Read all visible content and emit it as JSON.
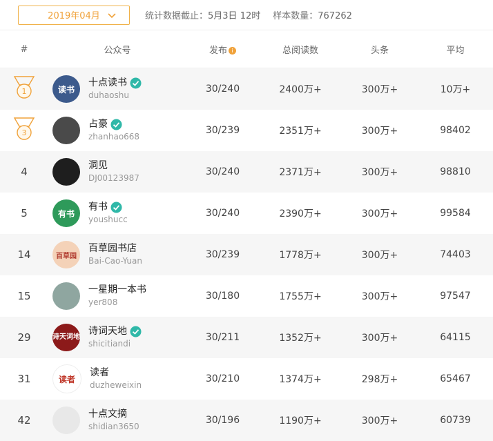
{
  "top": {
    "month": "2019年04月",
    "deadline_label": "统计数据截止：",
    "deadline_value": "5月3日 12时",
    "sample_label": "样本数量：",
    "sample_value": "767262"
  },
  "header": {
    "rank": "#",
    "account": "公众号",
    "publish": "发布",
    "total": "总阅读数",
    "headline": "头条",
    "avg": "平均"
  },
  "colors": {
    "accent": "#f0a23a",
    "verify": "#2fb8a8"
  },
  "rows": [
    {
      "rank": "1",
      "medal": true,
      "name": "十点读书",
      "id": "duhaoshu",
      "verified": true,
      "publish": "30/240",
      "total": "2400万+",
      "headline": "300万+",
      "avg": "10万+",
      "avatar_text": "读书",
      "avatar_color": "#3c5a8c"
    },
    {
      "rank": "3",
      "medal": true,
      "name": "占豪",
      "id": "zhanhao668",
      "verified": true,
      "publish": "30/239",
      "total": "2351万+",
      "headline": "300万+",
      "avg": "98402",
      "avatar_text": "",
      "avatar_color": "#4a4a4a"
    },
    {
      "rank": "4",
      "medal": false,
      "name": "洞见",
      "id": "DJ00123987",
      "verified": false,
      "publish": "30/240",
      "total": "2371万+",
      "headline": "300万+",
      "avg": "98810",
      "avatar_text": "",
      "avatar_color": "#1e1e1e"
    },
    {
      "rank": "5",
      "medal": false,
      "name": "有书",
      "id": "youshucc",
      "verified": true,
      "publish": "30/240",
      "total": "2390万+",
      "headline": "300万+",
      "avg": "99584",
      "avatar_text": "有书",
      "avatar_color": "#2e9a5a"
    },
    {
      "rank": "14",
      "medal": false,
      "name": "百草园书店",
      "id": "Bai-Cao-Yuan",
      "verified": false,
      "publish": "30/239",
      "total": "1778万+",
      "headline": "300万+",
      "avg": "74403",
      "avatar_text": "百草园",
      "avatar_color": "#f4d2b8"
    },
    {
      "rank": "15",
      "medal": false,
      "name": "一星期一本书",
      "id": "yer808",
      "verified": false,
      "publish": "30/180",
      "total": "1755万+",
      "headline": "300万+",
      "avg": "97547",
      "avatar_text": "",
      "avatar_color": "#8fa6a0"
    },
    {
      "rank": "29",
      "medal": false,
      "name": "诗词天地",
      "id": "shicitiandi",
      "verified": true,
      "publish": "30/211",
      "total": "1352万+",
      "headline": "300万+",
      "avg": "64115",
      "avatar_text": "诗天词地",
      "avatar_color": "#8c1a1a"
    },
    {
      "rank": "31",
      "medal": false,
      "name": "读者",
      "id": "duzheweixin",
      "verified": false,
      "publish": "30/210",
      "total": "1374万+",
      "headline": "298万+",
      "avg": "65467",
      "avatar_text": "读者",
      "avatar_color": "#ffffff"
    },
    {
      "rank": "42",
      "medal": false,
      "name": "十点文摘",
      "id": "shidian3650",
      "verified": false,
      "publish": "30/196",
      "total": "1190万+",
      "headline": "300万+",
      "avg": "60739",
      "avatar_text": "",
      "avatar_color": "#e8e8e8"
    }
  ]
}
